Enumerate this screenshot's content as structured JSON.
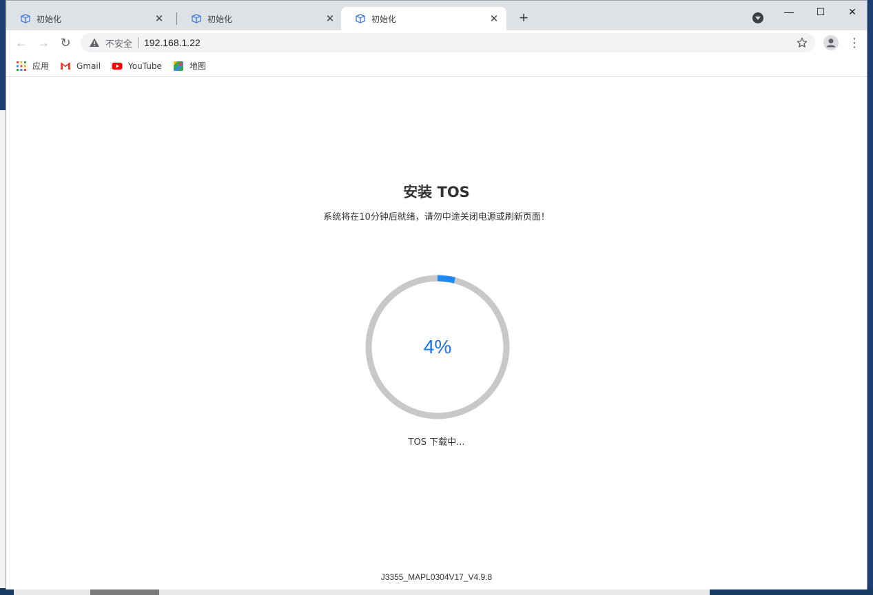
{
  "tabs": [
    {
      "title": "初始化",
      "close": "✕"
    },
    {
      "title": "初始化",
      "close": "✕"
    },
    {
      "title": "初始化",
      "close": "✕"
    }
  ],
  "newtab_label": "+",
  "window_controls": {
    "minimize": "—",
    "maximize": "☐",
    "close": "✕"
  },
  "toolbar": {
    "back": "←",
    "forward": "→",
    "reload": "↻",
    "insecure_label": "不安全",
    "url": "192.168.1.22",
    "menu": "⋮"
  },
  "bookmarks": [
    {
      "label": "应用",
      "icon": "apps-grid-icon"
    },
    {
      "label": "Gmail",
      "icon": "gmail-icon"
    },
    {
      "label": "YouTube",
      "icon": "youtube-icon"
    },
    {
      "label": "地图",
      "icon": "maps-icon"
    }
  ],
  "page": {
    "title": "安装 TOS",
    "subtitle": "系统将在10分钟后就绪，请勿中途关闭电源或刷新页面！",
    "progress": 4,
    "progress_label": "4%",
    "status": "TOS 下载中...",
    "version": "J3355_MAPL0304V17_V4.9.8"
  },
  "colors": {
    "accent": "#1a73e8",
    "progress_fill": "#1e88f0",
    "progress_track": "#c8c8c8"
  }
}
